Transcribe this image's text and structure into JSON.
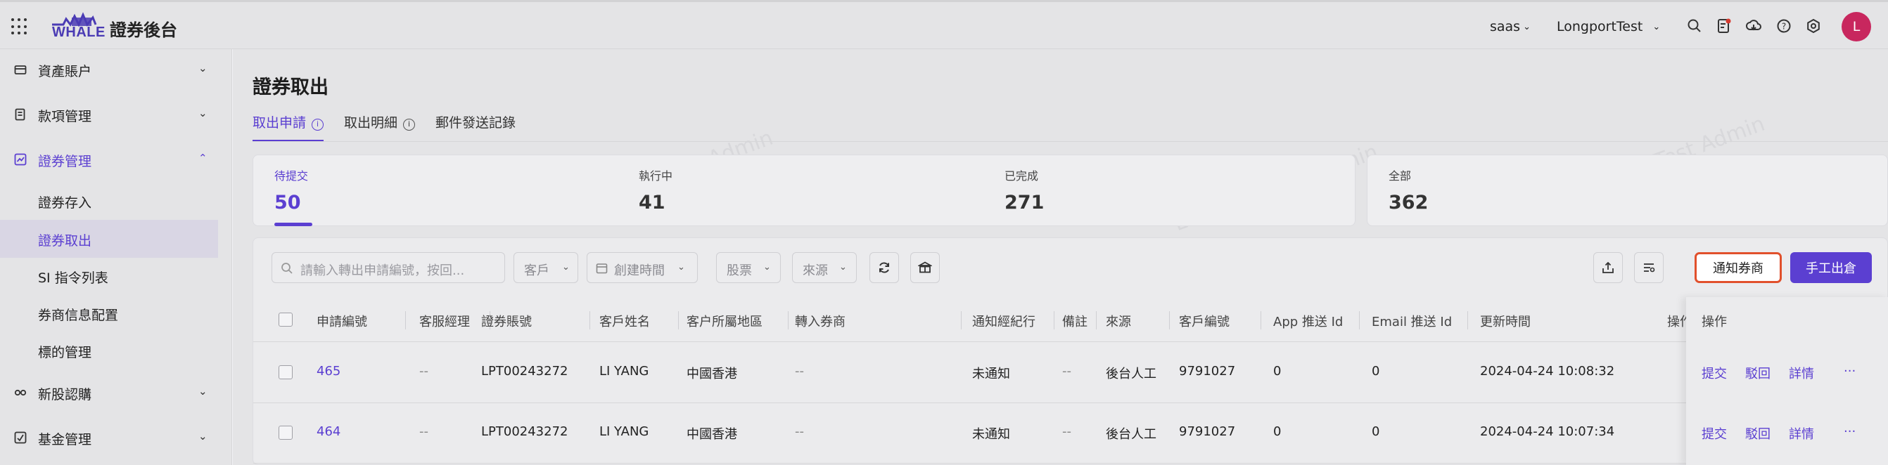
{
  "header": {
    "app_title": "證券後台",
    "logo_text": "WHALE",
    "tenant": "saas",
    "environment": "LongportTest",
    "avatar_initial": "L",
    "icons": [
      "apps-icon",
      "search-icon",
      "notification-doc-icon",
      "download-cloud-icon",
      "help-icon",
      "settings-icon"
    ]
  },
  "sidebar": {
    "groups": [
      {
        "label": "資產賬户",
        "icon": "wallet-icon"
      },
      {
        "label": "款項管理",
        "icon": "ledger-icon"
      },
      {
        "label": "證券管理",
        "icon": "chart-box-icon",
        "expanded": true
      },
      {
        "label": "新股認購",
        "icon": "ipo-icon"
      },
      {
        "label": "基金管理",
        "icon": "fund-icon"
      }
    ],
    "sub_items": [
      "證券存入",
      "證券取出",
      "SI 指令列表",
      "券商信息配置",
      "標的管理"
    ],
    "selected_sub": "證券取出"
  },
  "main": {
    "page_title": "證券取出",
    "tabs": [
      {
        "label": "取出申請"
      },
      {
        "label": "取出明細"
      },
      {
        "label": "郵件發送記錄"
      }
    ],
    "stats": [
      {
        "label": "待提交",
        "value": "50"
      },
      {
        "label": "執行中",
        "value": "41"
      },
      {
        "label": "已完成",
        "value": "271"
      },
      {
        "label": "全部",
        "value": "362"
      }
    ],
    "toolbar": {
      "search_placeholder": "請輸入轉出申請編號，按回...",
      "filter_customer": "客戶",
      "filter_created_time": "創建時間",
      "filter_stock": "股票",
      "filter_source": "來源",
      "notify_broker_label": "通知券商",
      "manual_out_label": "手工出倉"
    },
    "table": {
      "columns": [
        "申請編號",
        "客服經理",
        "證券賬號",
        "客戶姓名",
        "客户所屬地區",
        "轉入券商",
        "通知經紀行",
        "備註",
        "來源",
        "客戶編號",
        "App 推送 Id",
        "Email 推送 Id",
        "更新時間",
        "操作"
      ],
      "rows": [
        {
          "id": "465",
          "manager": "--",
          "account": "LPT00243272",
          "name": "LI YANG",
          "region": "中國香港",
          "broker": "--",
          "notify": "未通知",
          "remark": "--",
          "source": "後台人工",
          "customer_no": "9791027",
          "app_push": "0",
          "email_push": "0",
          "updated": "2024-04-24 10:08:32"
        },
        {
          "id": "464",
          "manager": "--",
          "account": "LPT00243272",
          "name": "LI YANG",
          "region": "中國香港",
          "broker": "--",
          "notify": "未通知",
          "remark": "--",
          "source": "後台人工",
          "customer_no": "9791027",
          "app_push": "0",
          "email_push": "0",
          "updated": "2024-04-24 10:07:34"
        }
      ],
      "actions": [
        "提交",
        "駁回",
        "詳情",
        "···"
      ]
    },
    "watermark": "LongPort Test Admin"
  }
}
